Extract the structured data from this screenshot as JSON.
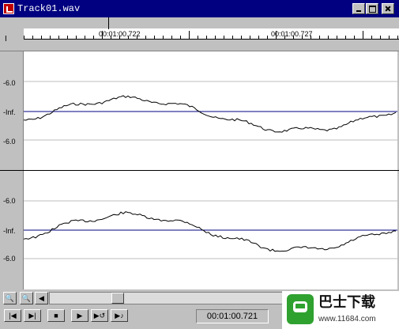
{
  "window": {
    "title": "Track01.wav"
  },
  "ruler": {
    "time_labels": [
      "00:01:00.722",
      "00:01:00.727"
    ]
  },
  "tracks": [
    {
      "labels": {
        "top": "-6.0",
        "mid": "-Inf.",
        "bottom": "-6.0"
      }
    },
    {
      "labels": {
        "top": "-6.0",
        "mid": "-Inf.",
        "bottom": "-6.0"
      }
    }
  ],
  "transport": {
    "time": "00:01:00.721",
    "icons": [
      "go-start-icon",
      "go-end-icon",
      "stop-icon",
      "play-icon",
      "play-loop-icon",
      "play-to-end-icon"
    ]
  },
  "zoom": {
    "icons": [
      "zoom-in-icon",
      "zoom-out-icon",
      "scroll-left-icon"
    ]
  },
  "colors": {
    "waveform": "#000000",
    "zero_line": "#000080",
    "grid": "#bdbdbd",
    "title_bar": "#000080"
  },
  "watermark": {
    "title": "巴士下载",
    "url": "www.11684.com"
  }
}
